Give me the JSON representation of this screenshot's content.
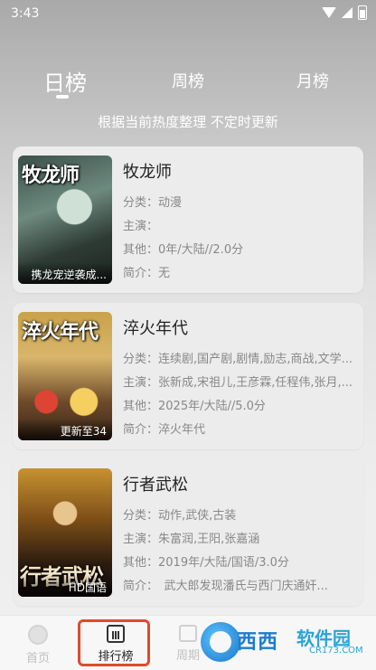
{
  "status": {
    "time": "3:43"
  },
  "tabs": [
    {
      "label": "日榜"
    },
    {
      "label": "周榜"
    },
    {
      "label": "月榜"
    }
  ],
  "subtitle": "根据当前热度整理 不定时更新",
  "items": [
    {
      "title": "牧龙师",
      "poster_title": "牧龙师",
      "badge": "携龙宠逆袭成...",
      "category": "分类：动漫",
      "cast": "主演：",
      "other": "其他：0年/大陆//2.0分",
      "intro": "简介：无"
    },
    {
      "title": "淬火年代",
      "poster_title": "淬火年代",
      "badge": "更新至34",
      "category": "分类：连续剧,国产剧,剧情,励志,商战,文学...",
      "cast": "主演：张新成,宋祖儿,王彦霖,任程伟,张月,...",
      "other": "其他：2025年/大陆//5.0分",
      "intro": "简介：淬火年代"
    },
    {
      "title": "行者武松",
      "poster_title": "行者武松",
      "badge": "HD国语",
      "category": "分类：动作,武侠,古装",
      "cast": "主演：朱富润,王阳,张嘉涵",
      "other": "其他：2019年/大陆/国语/3.0分",
      "intro": "简介：　武大郎发现潘氏与西门庆通奸..."
    }
  ],
  "bottom_nav": [
    {
      "label": "首页"
    },
    {
      "label": "排行榜"
    },
    {
      "label": "周期"
    }
  ],
  "watermark": {
    "text1": "西西",
    "text2": "软件园",
    "sub": "CR173.COM"
  },
  "colors": {
    "highlight": "#e04a2e",
    "watermark": "#1e7bd0"
  }
}
